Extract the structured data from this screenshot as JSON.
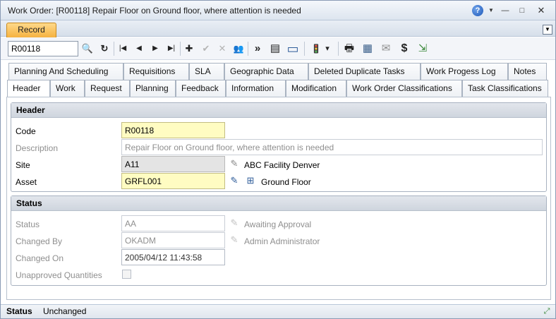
{
  "window": {
    "title": "Work Order: [R00118] Repair Floor on Ground floor, where attention is needed",
    "controls": {
      "help": "?",
      "dropdown": "▼",
      "minimize": "—",
      "maximize": "□",
      "close": "✕"
    }
  },
  "record_tab": {
    "label": "Record"
  },
  "toolbar": {
    "search_value": "R00118",
    "buttons": {
      "search": "🔍",
      "refresh": "↻",
      "first": "|◀",
      "prev": "◀",
      "next": "▶",
      "last": "▶|",
      "add": "✚",
      "save": "✔",
      "delete": "✕",
      "user": "👥",
      "more": "»",
      "list": "▤",
      "window": "▭",
      "signal": "🚦",
      "signal_drop": "▾",
      "print": "🖶",
      "calendar": "▦",
      "email": "✉",
      "cost": "$",
      "export": "⇲"
    }
  },
  "tabs_top": [
    "Planning And Scheduling",
    "Requisitions",
    "SLA",
    "Geographic Data",
    "Deleted Duplicate Tasks",
    "Work Progess Log",
    "Notes"
  ],
  "tabs_bottom": [
    "Header",
    "Work",
    "Request",
    "Planning",
    "Feedback",
    "Information",
    "Modification",
    "Work Order Classifications",
    "Task Classifications"
  ],
  "header_section": {
    "title": "Header",
    "code_label": "Code",
    "code_value": "R00118",
    "description_label": "Description",
    "description_value": "Repair Floor on Ground floor, where attention is needed",
    "site_label": "Site",
    "site_value": "A11",
    "site_desc": "ABC Facility Denver",
    "asset_label": "Asset",
    "asset_value": "GRFL001",
    "asset_desc": "Ground Floor"
  },
  "status_section": {
    "title": "Status",
    "status_label": "Status",
    "status_value": "AA",
    "status_desc": "Awaiting Approval",
    "changed_by_label": "Changed By",
    "changed_by_value": "OKADM",
    "changed_by_desc": "Admin Administrator",
    "changed_on_label": "Changed On",
    "changed_on_value": "2005/04/12 11:43:58",
    "unapproved_label": "Unapproved Quantities"
  },
  "statusbar": {
    "label": "Status",
    "value": "Unchanged",
    "resize": "⤢"
  }
}
